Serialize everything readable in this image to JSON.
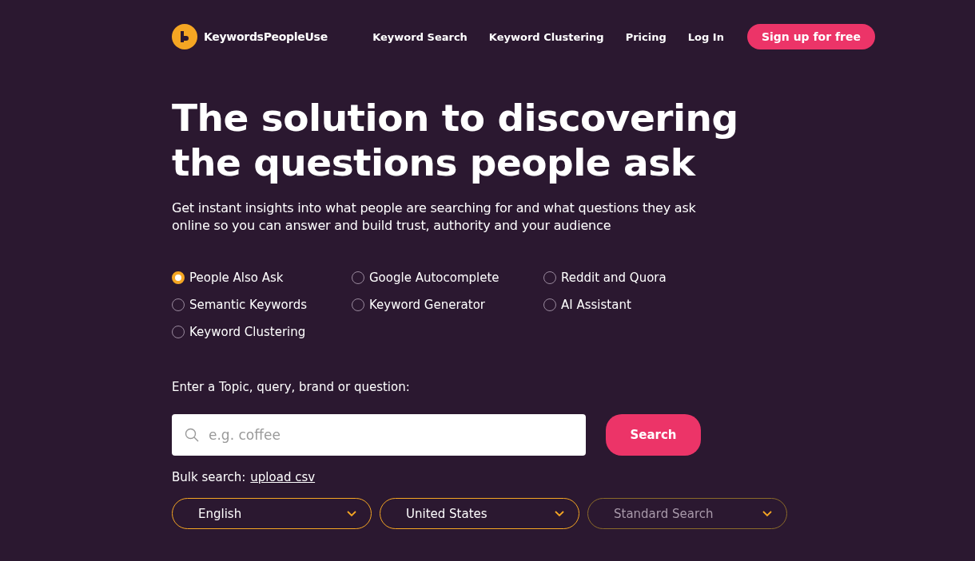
{
  "brand": {
    "name": "KeywordsPeopleUse"
  },
  "nav": {
    "links": [
      "Keyword Search",
      "Keyword Clustering",
      "Pricing",
      "Log In"
    ],
    "cta": "Sign up for free"
  },
  "hero": {
    "title_lines": [
      "The solution to discovering",
      "the questions people ask"
    ],
    "subtitle": "Get instant insights into what people are searching for and what questions they ask online so you can answer and build trust, authority and your audience"
  },
  "modes": [
    {
      "label": "People Also Ask",
      "selected": true
    },
    {
      "label": "Google Autocomplete",
      "selected": false
    },
    {
      "label": "Reddit and Quora",
      "selected": false
    },
    {
      "label": "Semantic Keywords",
      "selected": false
    },
    {
      "label": "Keyword Generator",
      "selected": false
    },
    {
      "label": "AI Assistant",
      "selected": false
    },
    {
      "label": "Keyword Clustering",
      "selected": false
    }
  ],
  "search": {
    "label": "Enter a Topic, query, brand or question:",
    "placeholder": "e.g. coffee",
    "button": "Search"
  },
  "bulk": {
    "label": "Bulk search:",
    "link": "upload csv"
  },
  "dropdowns": [
    {
      "value": "English",
      "disabled": false
    },
    {
      "value": "United States",
      "disabled": false
    },
    {
      "value": "Standard Search",
      "disabled": true
    }
  ]
}
